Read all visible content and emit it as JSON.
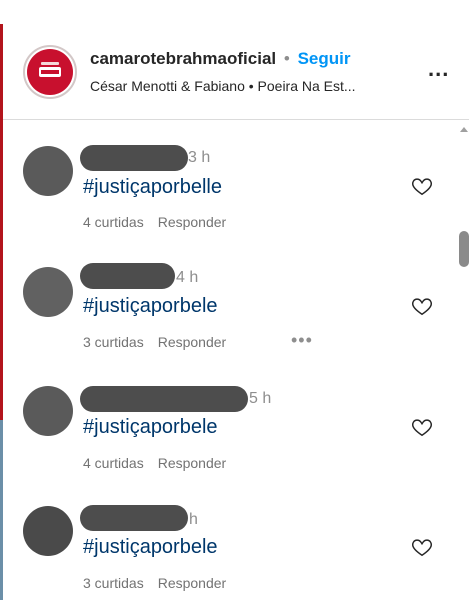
{
  "post_header": {
    "username": "camarotebrahmaoficial",
    "separator": "•",
    "follow_label": "Seguir",
    "audio_line": "César Menotti & Fabiano • Poeira Na Est...",
    "more_label": "..."
  },
  "comments": [
    {
      "time": "3 h",
      "text": "#justiçaporbelle",
      "likes": "4 curtidas",
      "reply": "Responder"
    },
    {
      "time": "4 h",
      "text": "#justiçaporbele",
      "likes": "3 curtidas",
      "reply": "Responder",
      "more": "•••"
    },
    {
      "time": "5 h",
      "text": "#justiçaporbele",
      "likes": "4 curtidas",
      "reply": "Responder"
    },
    {
      "time": "h",
      "text": "#justiçaporbele",
      "likes": "3 curtidas",
      "reply": "Responder"
    }
  ],
  "icons": {
    "like": "heart-outline-icon",
    "more": "ellipsis-icon"
  },
  "colors": {
    "hashtag": "#00376b",
    "follow": "#0095f6",
    "muted": "#737373",
    "brand_red": "#c8102e"
  }
}
